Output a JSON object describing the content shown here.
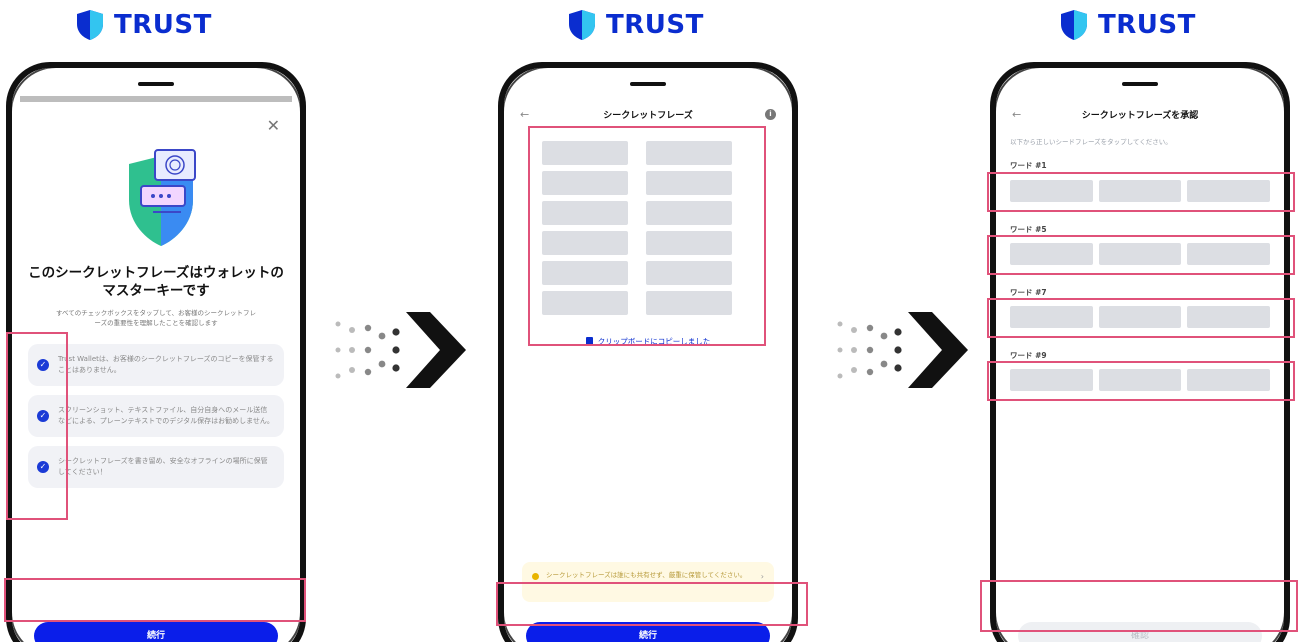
{
  "brand": {
    "name": "TRUST",
    "color": "#0a2dcf"
  },
  "phone1": {
    "title_line1": "このシークレットフレーズはウォレットの",
    "title_line2": "マスターキーです",
    "subtitle_line1": "すべてのチェックボックスをタップして、お客様のシークレットフレ",
    "subtitle_line2": "ーズの重要性を理解したことを確認します",
    "checks": [
      {
        "text": "Trust Walletは、お客様のシークレットフレーズのコピーを保管することはありません。"
      },
      {
        "text": "スクリーンショット、テキストファイル、自分自身へのメール送信などによる、プレーンテキストでのデジタル保存はお勧めしません。"
      },
      {
        "text": "シークレットフレーズを書き留め、安全なオフラインの場所に保管してください！"
      }
    ],
    "continue_label": "続行"
  },
  "phone2": {
    "title": "シークレットフレーズ",
    "clipboard_label": "クリップボードにコピーしました",
    "warning_text": "シークレットフレーズは誰にも共有せず、厳重に保管してください。",
    "continue_label": "続行"
  },
  "phone3": {
    "title": "シークレットフレーズを承認",
    "subtitle": "以下から正しいシードフレーズをタップしてください。",
    "words": [
      {
        "label": "ワード #1"
      },
      {
        "label": "ワード #5"
      },
      {
        "label": "ワード #7"
      },
      {
        "label": "ワード #9"
      }
    ],
    "confirm_label": "確認"
  },
  "colors": {
    "accent": "#0a1eea",
    "highlight": "#e0527a",
    "slot": "#dcdee3"
  }
}
